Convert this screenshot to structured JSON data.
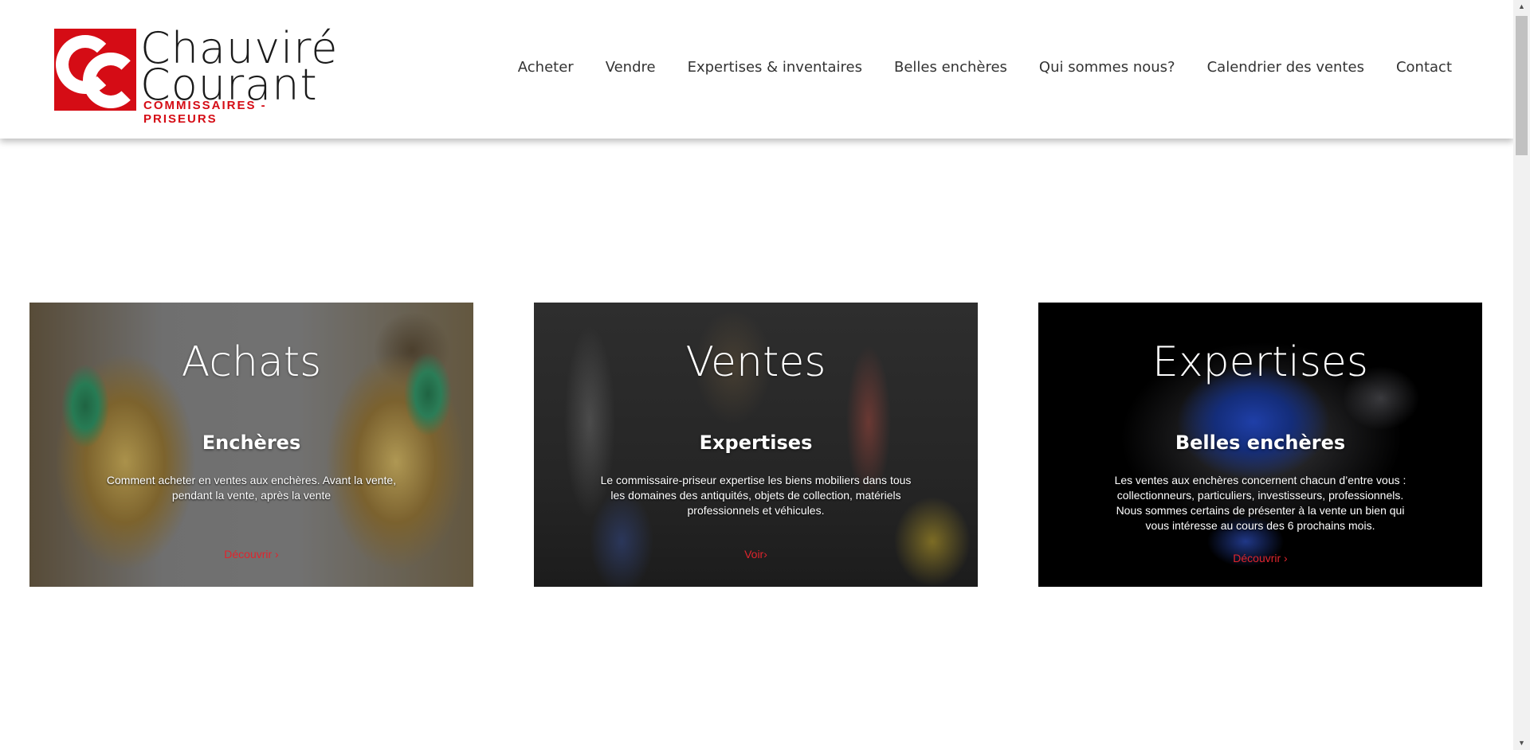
{
  "header": {
    "logo": {
      "line1": "Chauviré",
      "line2": "Courant",
      "line3": "COMMISSAIRES - PRISEURS",
      "brand_color": "#d50c15"
    },
    "nav": [
      {
        "label": "Acheter"
      },
      {
        "label": "Vendre"
      },
      {
        "label": "Expertises & inventaires"
      },
      {
        "label": "Belles enchères"
      },
      {
        "label": "Qui sommes nous?"
      },
      {
        "label": "Calendrier des ventes"
      },
      {
        "label": "Contact"
      }
    ]
  },
  "cards": [
    {
      "title": "Achats",
      "subtitle": "Enchères",
      "text": "Comment acheter en ventes aux enchères. Avant la vente, pendant la vente, après la vente",
      "link": "Découvrir ›"
    },
    {
      "title": "Ventes",
      "subtitle": "Expertises",
      "text": "Le commissaire-priseur expertise les biens mobiliers dans tous les domaines des antiquités, objets de collection, matériels professionnels et véhicules.",
      "link": "Voir›"
    },
    {
      "title": "Expertises",
      "subtitle": "Belles enchères",
      "text": "Les ventes aux enchères concernent chacun d’entre vous : collectionneurs, particuliers, investisseurs, professionnels. Nous sommes certains de présenter à la vente un bien qui vous intéresse au cours des 6 prochains mois.",
      "link": "Découvrir ›"
    }
  ],
  "colors": {
    "accent_red": "#e0252d",
    "nav_text": "#333333"
  }
}
